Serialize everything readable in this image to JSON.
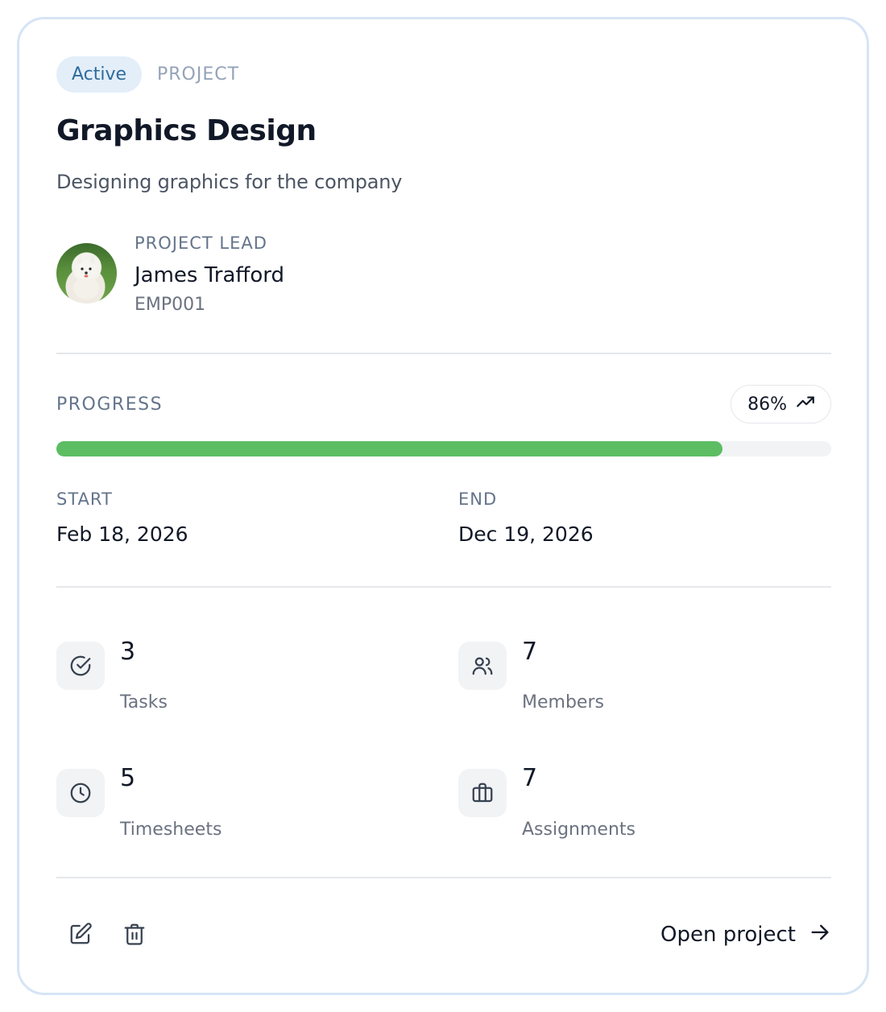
{
  "header": {
    "status_badge": "Active",
    "kind": "PROJECT",
    "title": "Graphics Design",
    "subtitle": "Designing graphics for the company"
  },
  "lead": {
    "label": "PROJECT LEAD",
    "name": "James Trafford",
    "employee_id": "EMP001"
  },
  "progress": {
    "label": "PROGRESS",
    "percent_text": "86%",
    "percent": 86,
    "trend_icon": "trending-up-icon",
    "bar_color": "#5cbd62"
  },
  "dates": {
    "start_label": "START",
    "start_value": "Feb 18, 2026",
    "end_label": "END",
    "end_value": "Dec 19, 2026"
  },
  "stats": [
    {
      "icon": "check-circle-icon",
      "value": "3",
      "label": "Tasks"
    },
    {
      "icon": "users-icon",
      "value": "7",
      "label": "Members"
    },
    {
      "icon": "clock-icon",
      "value": "5",
      "label": "Timesheets"
    },
    {
      "icon": "briefcase-icon",
      "value": "7",
      "label": "Assignments"
    }
  ],
  "footer": {
    "edit_icon": "edit-icon",
    "delete_icon": "trash-icon",
    "open_label": "Open project",
    "open_icon": "arrow-right-icon"
  },
  "colors": {
    "badge_bg": "#e3eef9",
    "badge_text": "#2f6b9c",
    "card_border": "#d6e4f5"
  }
}
